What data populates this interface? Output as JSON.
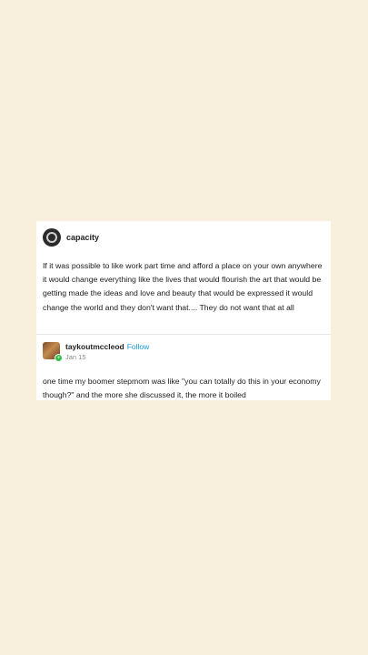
{
  "post": {
    "username": "capacity",
    "avatar_icon": "capacity-avatar-icon",
    "body": "If it was possible to like work part time and afford a place on your own anywhere it would change everything like the lives that would flourish the art that would be getting made the ideas and love and beauty that would be expressed it would change the world and they don't want that.... They do not want that at all"
  },
  "reblog": {
    "username": "taykoutmccleod",
    "follow_label": "Follow",
    "date": "Jan 15",
    "badge_icon": "plus-icon",
    "body": "one time my boomer stepmom was like \"you can totally do this in your economy though?\" and the more she discussed it, the more it boiled"
  },
  "colors": {
    "background": "#f8efdc",
    "follow": "#1a9bd7",
    "badge": "#2fbf4a"
  }
}
